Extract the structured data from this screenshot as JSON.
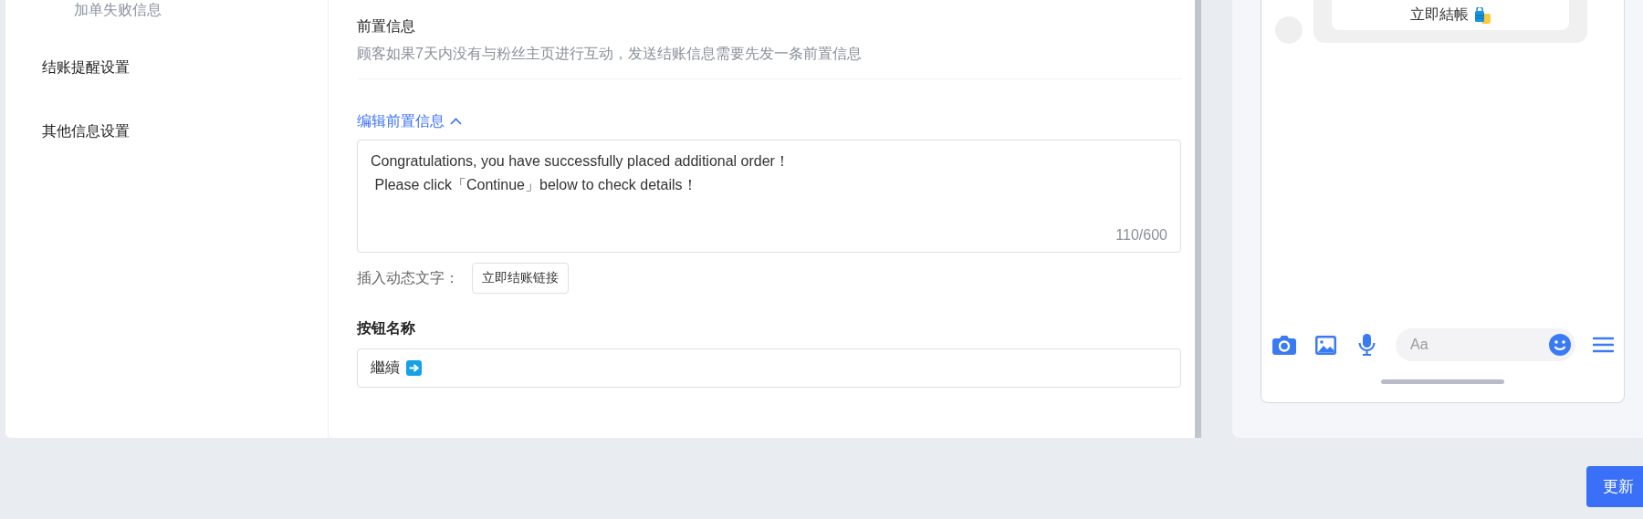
{
  "sidebar": {
    "items": [
      {
        "label": "加单失败信息",
        "kind": "sub"
      },
      {
        "label": "结账提醒设置",
        "kind": "main"
      },
      {
        "label": "其他信息设置",
        "kind": "main"
      }
    ]
  },
  "pre_message": {
    "title": "前置信息",
    "description": "顾客如果7天内没有与粉丝主页进行互动，发送结账信息需要先发一条前置信息",
    "edit_toggle": {
      "label": "编辑前置信息",
      "expanded": true
    },
    "message": "Congratulations, you have successfully placed additional order！\n Please click「Continue」below to check details！",
    "counter": "110/600",
    "insert_label": "插入动态文字：",
    "insert_buttons": [
      "立即结账链接"
    ]
  },
  "button_name": {
    "label": "按钮名称",
    "value": "繼續"
  },
  "preview": {
    "bubble_button": "立即結帳",
    "composer_placeholder": "Aa"
  },
  "update_button": "更新"
}
